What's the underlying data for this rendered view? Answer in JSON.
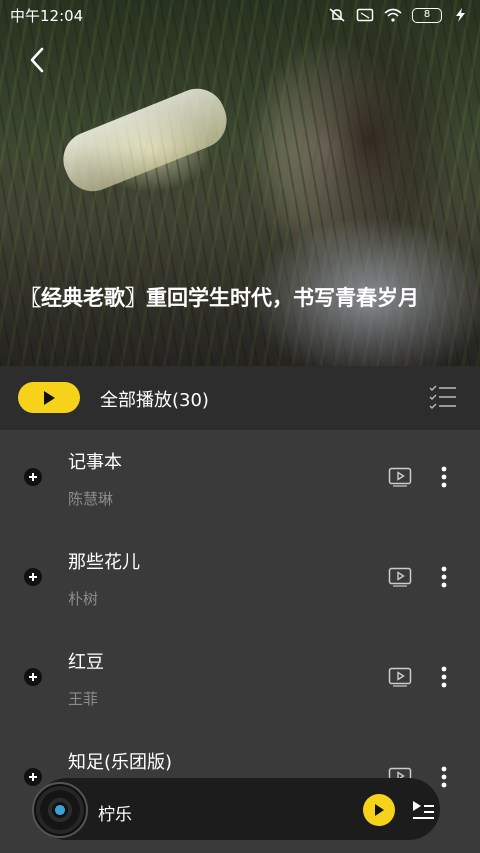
{
  "status_bar": {
    "time": "中午12:04",
    "battery": "8"
  },
  "header": {
    "title": "〖经典老歌〗重回学生时代，书写青春岁月"
  },
  "play_all": {
    "label": "全部播放(30)"
  },
  "songs": [
    {
      "name": "记事本",
      "artist": "陈慧琳"
    },
    {
      "name": "那些花儿",
      "artist": "朴树"
    },
    {
      "name": "红豆",
      "artist": "王菲"
    },
    {
      "name": "知足(乐团版)",
      "artist": ""
    }
  ],
  "mini_player": {
    "title": "柠乐"
  },
  "colors": {
    "accent": "#f7d21b",
    "background": "#3a3a3a",
    "playbar_background": "#2d2d2d",
    "secondary_text": "#8c8c8c"
  },
  "icons": {
    "back": "chevron-left-icon",
    "play": "play-icon",
    "multi_select": "checklist-icon",
    "add": "plus-circle-icon",
    "mv": "video-icon",
    "more": "more-vertical-icon",
    "playlist": "playlist-icon"
  }
}
